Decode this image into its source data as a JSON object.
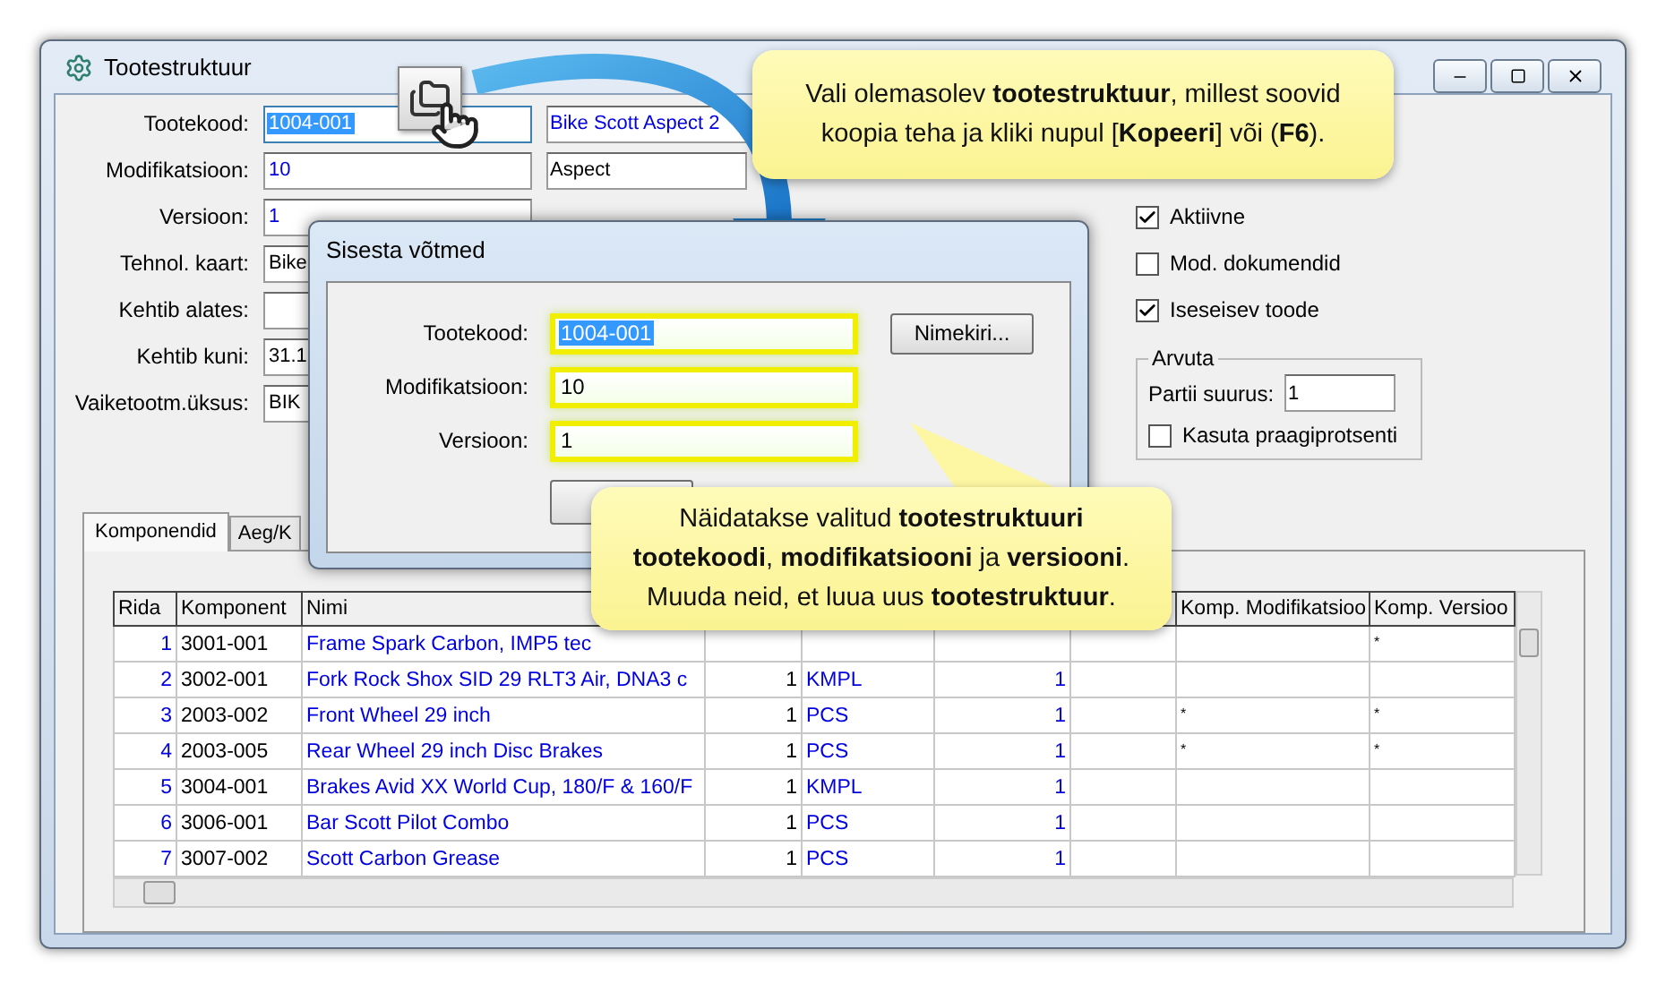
{
  "window": {
    "title": "Tootestruktuur"
  },
  "form": {
    "fields": [
      {
        "label": "Tootekood:",
        "value": "1004-001",
        "kind": "key",
        "highlighted": true,
        "extra": {
          "value": "Bike Scott Aspect 2",
          "kind": "key"
        }
      },
      {
        "label": "Modifikatsioon:",
        "value": "10",
        "kind": "key",
        "highlighted": false,
        "extra": {
          "value": "Aspect",
          "kind": "plain"
        }
      },
      {
        "label": "Versioon:",
        "value": "1",
        "kind": "key",
        "highlighted": false
      },
      {
        "label": "Tehnol. kaart:",
        "value": "Bike",
        "kind": "plain",
        "highlighted": false
      },
      {
        "label": "Kehtib alates:",
        "kind": "plain",
        "highlighted": false
      },
      {
        "label": "Kehtib kuni:",
        "value": "31.1",
        "kind": "plain",
        "highlighted": false
      },
      {
        "label": "Vaiketootm.üksus:",
        "value": "BIK",
        "kind": "plain",
        "highlighted": false
      }
    ]
  },
  "side": {
    "options": [
      {
        "label": "Aktiivne",
        "checked": true
      },
      {
        "label": "Mod. dokumendid",
        "checked": false
      },
      {
        "label": "Iseseisev toode",
        "checked": true
      }
    ],
    "group": {
      "title": "Arvuta",
      "label": "Partii suurus:",
      "value": "1",
      "option": {
        "label": "Kasuta praagiprotsenti",
        "checked": false
      }
    }
  },
  "tabs": [
    {
      "label": "Komponendid",
      "selected": true
    },
    {
      "label": "Aeg/K",
      "selected": false
    }
  ],
  "table": {
    "columns": [
      "Rida",
      "Komponent",
      "Nimi",
      "Komp. Modifikatsioo",
      "Komp. Versioo"
    ],
    "rows": [
      {
        "rida": "1",
        "komponent": "3001-001",
        "nimi": "Frame Spark Carbon, IMP5 tec",
        "komp_versioon": "*"
      },
      {
        "rida": "2",
        "komponent": "3002-001",
        "nimi": "Fork Rock Shox SID 29 RLT3 Air, DNA3 c",
        "column_4": "1",
        "column_5": "KMPL",
        "column_6": "1"
      },
      {
        "rida": "3",
        "komponent": "2003-002",
        "nimi": "Front Wheel 29 inch",
        "column_4": "1",
        "column_5": "PCS",
        "column_6": "1",
        "komp_modifikatsioon": "*",
        "komp_versioon": "*"
      },
      {
        "rida": "4",
        "komponent": "2003-005",
        "nimi": "Rear Wheel 29 inch Disc Brakes",
        "column_4": "1",
        "column_5": "PCS",
        "column_6": "1",
        "komp_modifikatsioon": "*",
        "komp_versioon": "*"
      },
      {
        "rida": "5",
        "komponent": "3004-001",
        "nimi": "Brakes Avid XX World Cup, 180/F & 160/F",
        "column_4": "1",
        "column_5": "KMPL",
        "column_6": "1"
      },
      {
        "rida": "6",
        "komponent": "3006-001",
        "nimi": "Bar Scott Pilot Combo",
        "column_4": "1",
        "column_5": "PCS",
        "column_6": "1"
      },
      {
        "rida": "7",
        "komponent": "3007-002",
        "nimi": "Scott Carbon Grease",
        "column_4": "1",
        "column_5": "PCS",
        "column_6": "1"
      }
    ]
  },
  "dialog": {
    "title": "Sisesta võtmed",
    "fields": [
      {
        "label": "Tootekood:",
        "value": "1004-001",
        "highlighted": true
      },
      {
        "label": "Modifikatsioon:",
        "value": "10",
        "highlighted": false
      },
      {
        "label": "Versioon:",
        "value": "1",
        "highlighted": false
      }
    ],
    "list_button": "Nimekiri..."
  },
  "callouts": [
    {
      "lines": [
        "Vali olemasolev **tootestruktuur**, millest soovid",
        "koopia teha ja kliki nupul [**Kopeeri**] või (**F6**)."
      ]
    },
    {
      "lines": [
        "Näidatakse valitud **tootestruktuuri**",
        "**tootekoodi**, **modifikatsiooni**  ja **versiooni**.",
        "Muuda neid, et luua uus **tootestruktuur**."
      ]
    }
  ]
}
